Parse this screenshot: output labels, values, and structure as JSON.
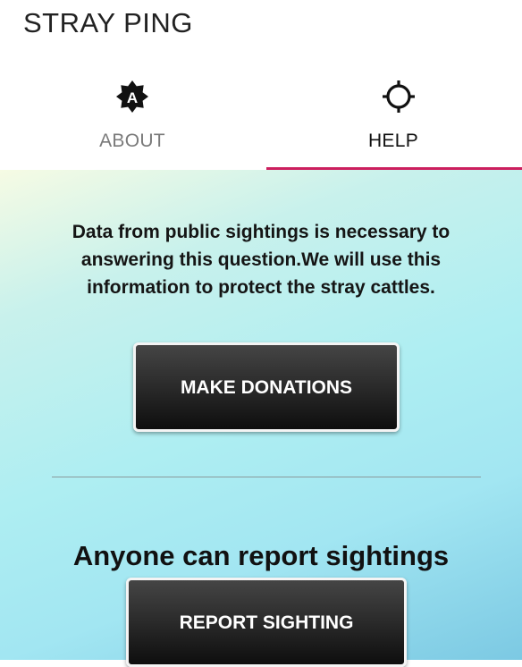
{
  "app_bar": {
    "title": "STRAY PING"
  },
  "tabs": [
    {
      "label": "ABOUT",
      "icon": "brightness-auto-icon",
      "selected": false
    },
    {
      "label": "HELP",
      "icon": "gps-target-icon",
      "selected": true
    }
  ],
  "colors": {
    "tab_indicator": "#cc1f5e",
    "button_bg": "#2a2a2a",
    "button_text": "#ffffff"
  },
  "content": {
    "info_text": "Data from public sightings is necessary to answering this question.We will use this information to protect the stray cattles.",
    "donate_button_label": "MAKE DONATIONS",
    "section_title": "Anyone can report sightings",
    "report_button_label": "REPORT SIGHTING"
  }
}
